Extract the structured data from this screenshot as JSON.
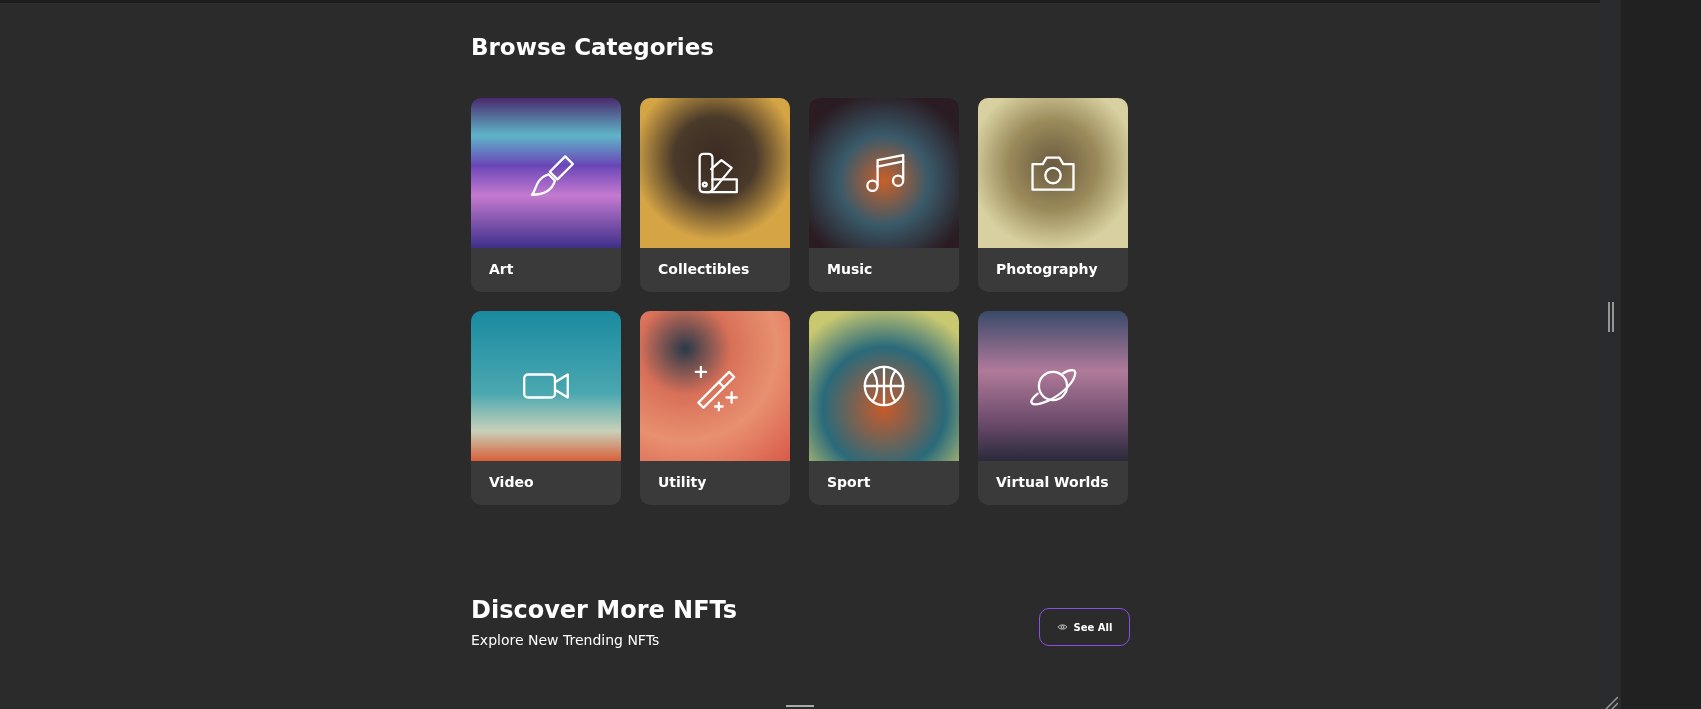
{
  "browse": {
    "title": "Browse Categories",
    "categories": [
      {
        "label": "Art",
        "kind": "brush"
      },
      {
        "label": "Collectibles",
        "kind": "swatch"
      },
      {
        "label": "Music",
        "kind": "music"
      },
      {
        "label": "Photography",
        "kind": "camera"
      },
      {
        "label": "Video",
        "kind": "video"
      },
      {
        "label": "Utility",
        "kind": "wand"
      },
      {
        "label": "Sport",
        "kind": "ball"
      },
      {
        "label": "Virtual Worlds",
        "kind": "planet"
      }
    ]
  },
  "discover": {
    "title": "Discover More NFTs",
    "subtitle": "Explore New Trending NFTs",
    "button": "See All"
  }
}
